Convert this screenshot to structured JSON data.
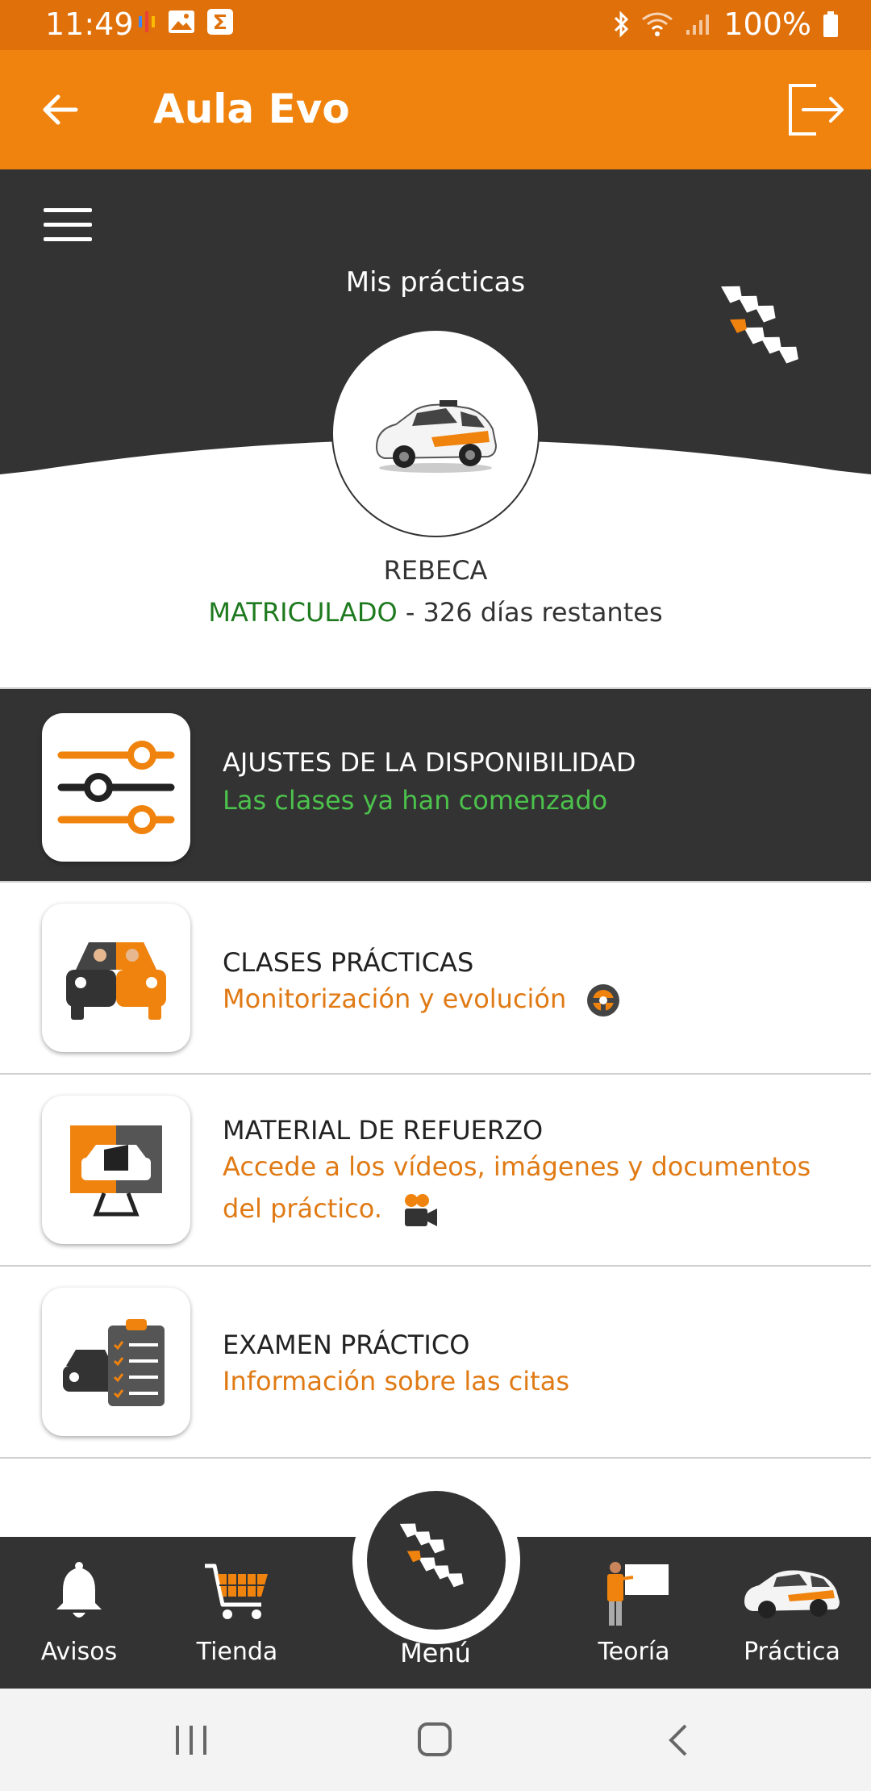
{
  "status_bar": {
    "time": "11:49",
    "battery": "100%"
  },
  "app_bar": {
    "title": "Aula Evo"
  },
  "header": {
    "title": "Mis prácticas"
  },
  "user": {
    "name": "REBECA",
    "status": "MATRICULADO",
    "remaining": " - 326 días restantes"
  },
  "items": [
    {
      "title": "AJUSTES DE LA DISPONIBILIDAD",
      "subtitle": "Las clases ya han comenzado"
    },
    {
      "title": "CLASES PRÁCTICAS",
      "subtitle": "Monitorización y evolución"
    },
    {
      "title": "MATERIAL DE REFUERZO",
      "subtitle": "Accede a los vídeos, imágenes y documentos del práctico."
    },
    {
      "title": "EXAMEN PRÁCTICO",
      "subtitle": "Información sobre las citas"
    }
  ],
  "bottom_nav": {
    "avisos": "Avisos",
    "tienda": "Tienda",
    "menu": "Menú",
    "teoria": "Teoría",
    "practica": "Práctica"
  },
  "colors": {
    "brand_orange": "#f0830e",
    "dark": "#333333",
    "enrolled_green": "#1e7a1e",
    "link_orange": "#e07a14",
    "success_green": "#4cc24c"
  }
}
